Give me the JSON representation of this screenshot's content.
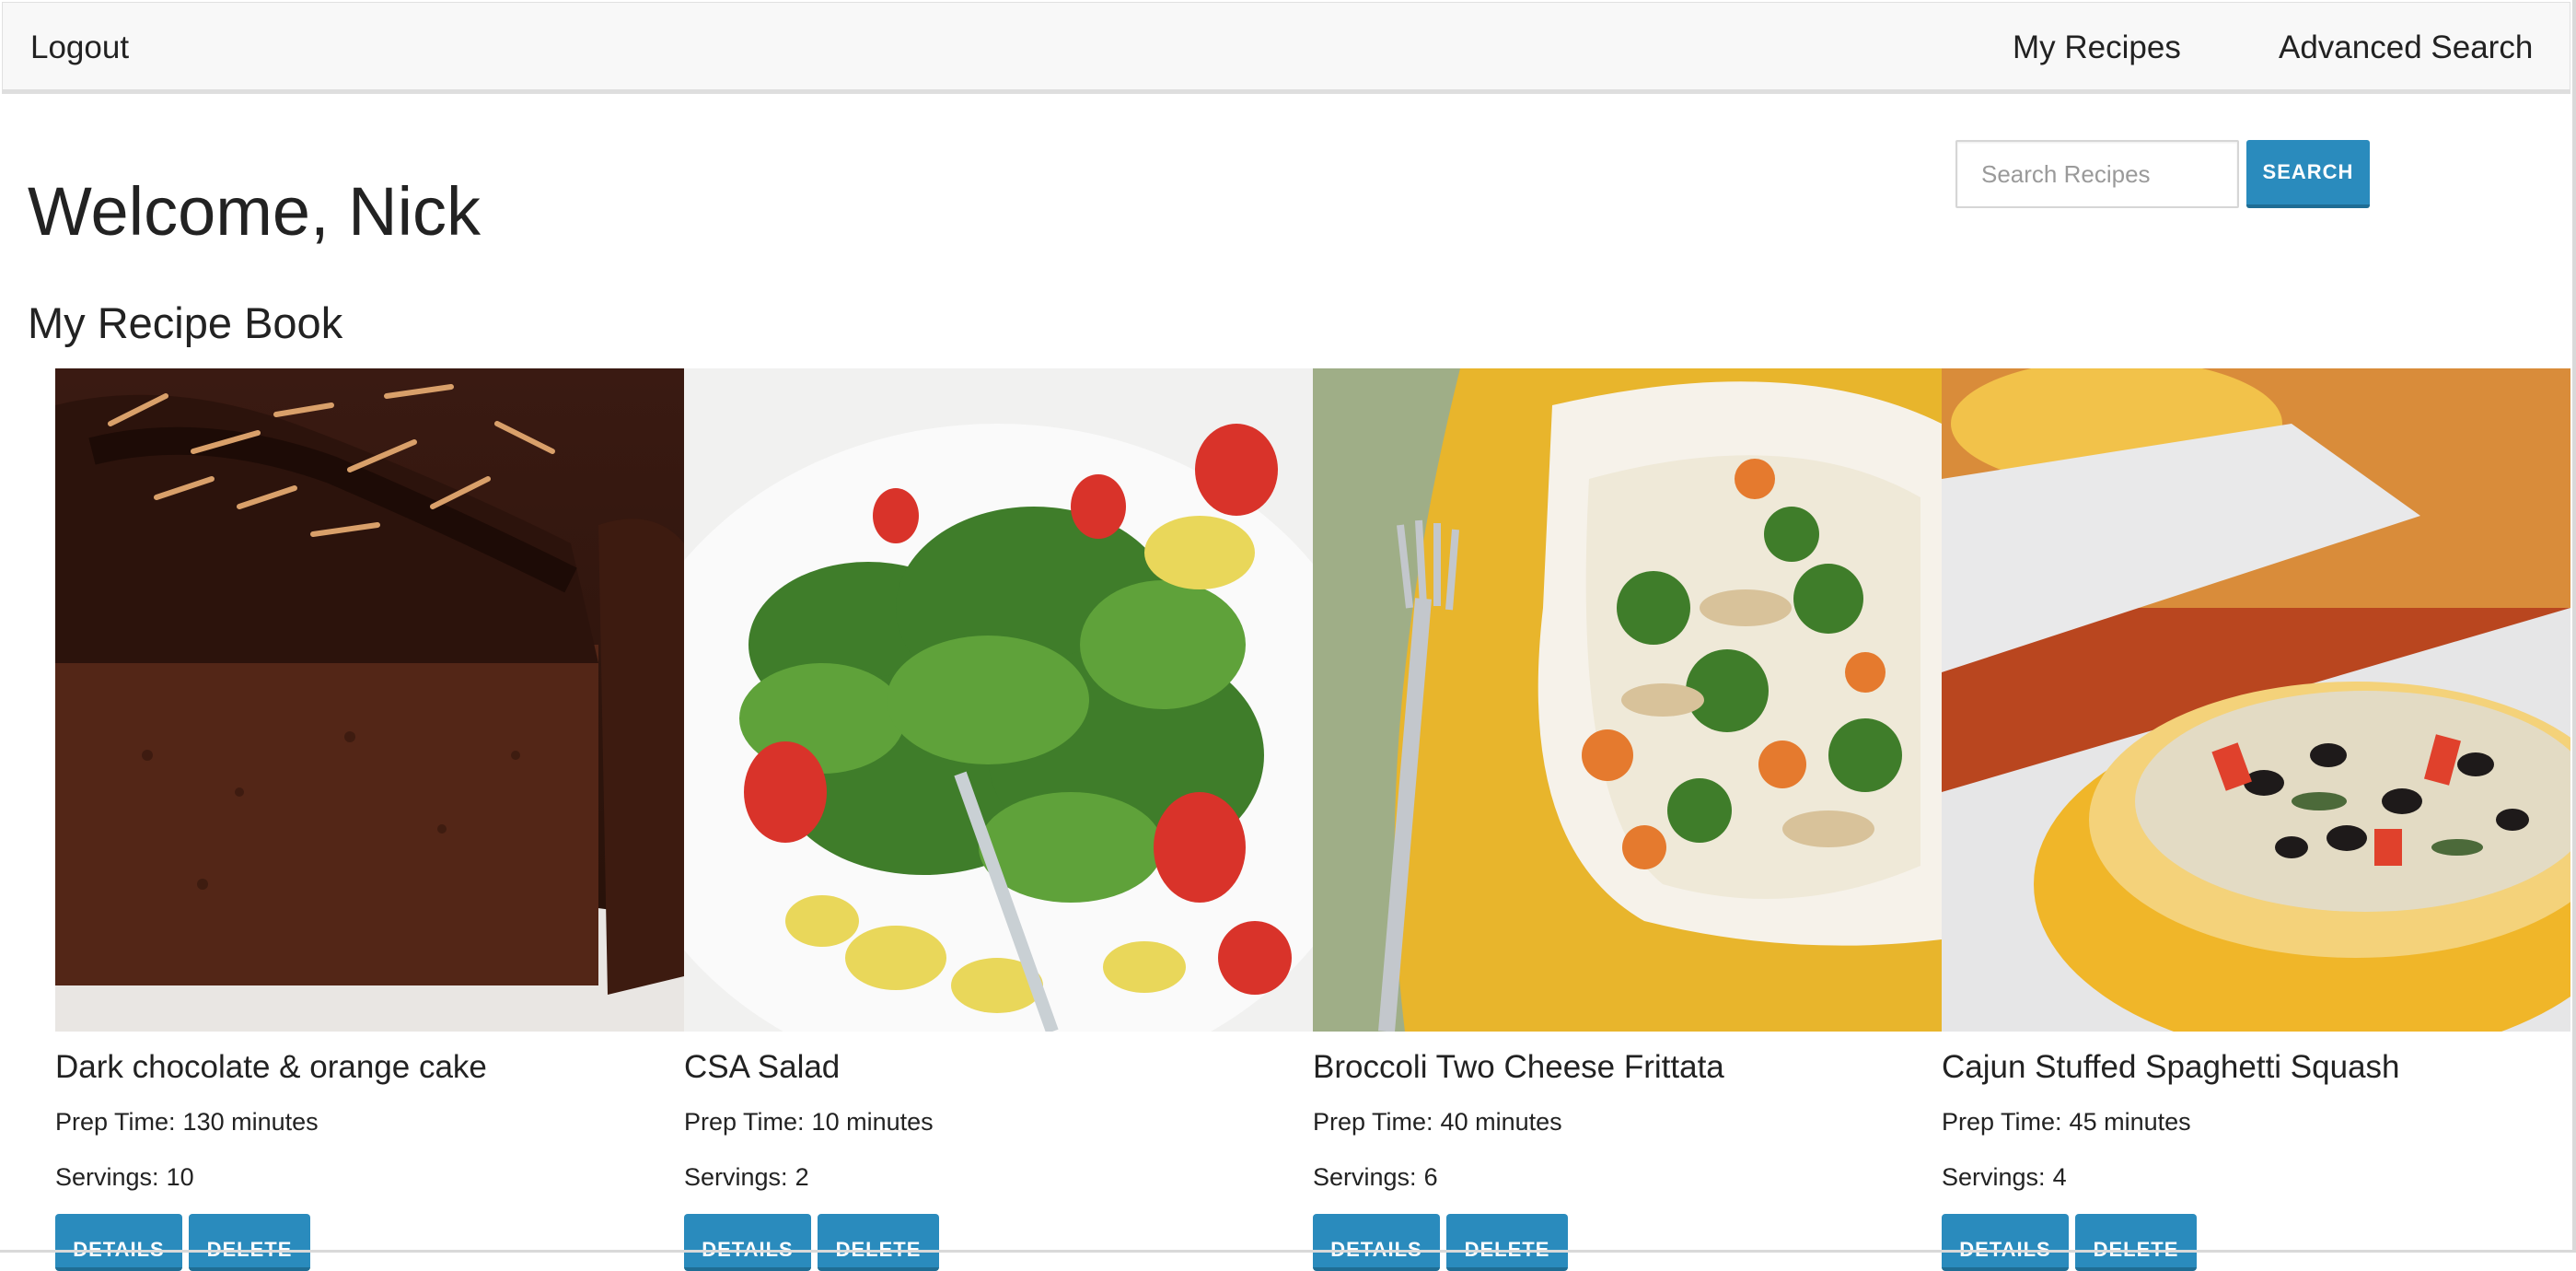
{
  "nav": {
    "logout": "Logout",
    "my_recipes": "My Recipes",
    "advanced_search": "Advanced Search"
  },
  "header": {
    "welcome": "Welcome, Nick",
    "book_title": "My Recipe Book"
  },
  "search": {
    "placeholder": "Search Recipes",
    "button": "SEARCH"
  },
  "labels": {
    "prep_time": "Prep Time:",
    "servings": "Servings:",
    "details": "DETAILS",
    "delete": "DELETE"
  },
  "recipes": [
    {
      "title": "Dark chocolate & orange cake",
      "prep_time": "130 minutes",
      "servings": "10"
    },
    {
      "title": "CSA Salad",
      "prep_time": "10 minutes",
      "servings": "2"
    },
    {
      "title": "Broccoli Two Cheese Frittata",
      "prep_time": "40 minutes",
      "servings": "6"
    },
    {
      "title": "Cajun Stuffed Spaghetti Squash",
      "prep_time": "45 minutes",
      "servings": "4"
    }
  ],
  "colors": {
    "accent": "#2a8bbd",
    "navbar": "#f8f8f8",
    "text": "#222222"
  }
}
